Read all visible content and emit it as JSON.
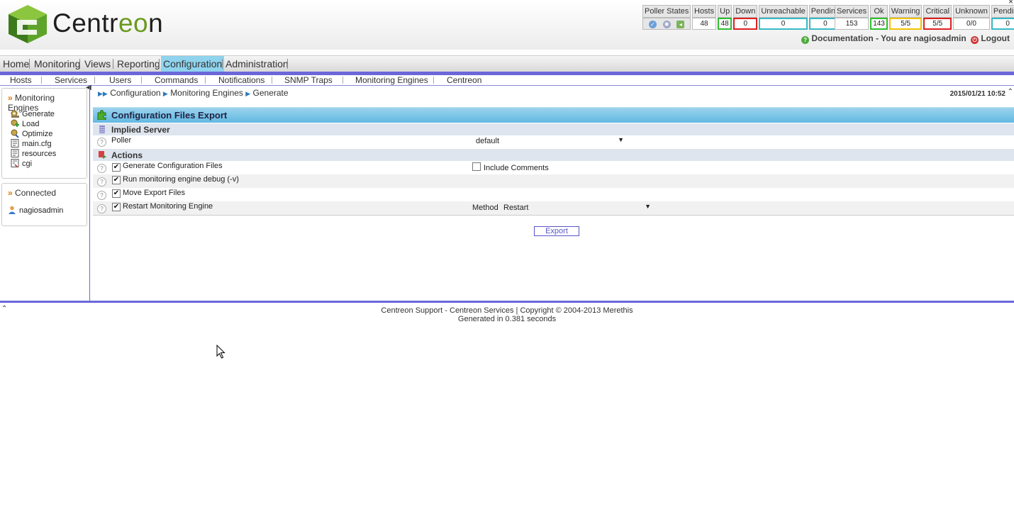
{
  "brand": {
    "name_part1": "Centr",
    "name_part2": "eo",
    "name_part3": "n"
  },
  "status": {
    "poller": {
      "header": "Poller States"
    },
    "hosts": {
      "headers": [
        "Hosts",
        "Up",
        "Down",
        "Unreachable",
        "Pending"
      ],
      "values": [
        "48",
        "48",
        "0",
        "0",
        "0"
      ]
    },
    "services": {
      "headers": [
        "Services",
        "Ok",
        "Warning",
        "Critical",
        "Unknown",
        "Pending"
      ],
      "values": [
        "153",
        "143",
        "5/5",
        "5/5",
        "0/0",
        "0"
      ]
    }
  },
  "userline": {
    "documentation": "Documentation",
    "you_are": " - You are nagiosadmin",
    "logout": "Logout"
  },
  "mainmenu": [
    "Home",
    "Monitoring",
    "Views",
    "Reporting",
    "Configuration",
    "Administration"
  ],
  "submenu": [
    "Hosts",
    "Services",
    "Users",
    "Commands",
    "Notifications",
    "SNMP Traps",
    "Monitoring Engines",
    "Centreon"
  ],
  "sidebar": {
    "section_title": "Monitoring Engines",
    "items": [
      "Generate",
      "Load",
      "Optimize",
      "main.cfg",
      "resources",
      "cgi"
    ],
    "connected_title": "Connected",
    "user": "nagiosadmin"
  },
  "breadcrumb": [
    "Configuration",
    "Monitoring Engines",
    "Generate"
  ],
  "datetime": "2015/01/21 10:52",
  "form": {
    "title": "Configuration Files Export",
    "implied_server": "Implied Server",
    "poller_label": "Poller",
    "poller_value": "default",
    "actions": "Actions",
    "generate": "Generate Configuration Files",
    "include_comments": "Include Comments",
    "debug": "Run monitoring engine debug (-v)",
    "move": "Move Export Files",
    "restart": "Restart Monitoring Engine",
    "method_label": "Method",
    "method_value": "Restart",
    "export_button": "Export"
  },
  "footer": {
    "line1": "Centreon Support - Centreon Services | Copyright © 2004-2013 Merethis",
    "line2": "Generated in 0.381 seconds"
  }
}
